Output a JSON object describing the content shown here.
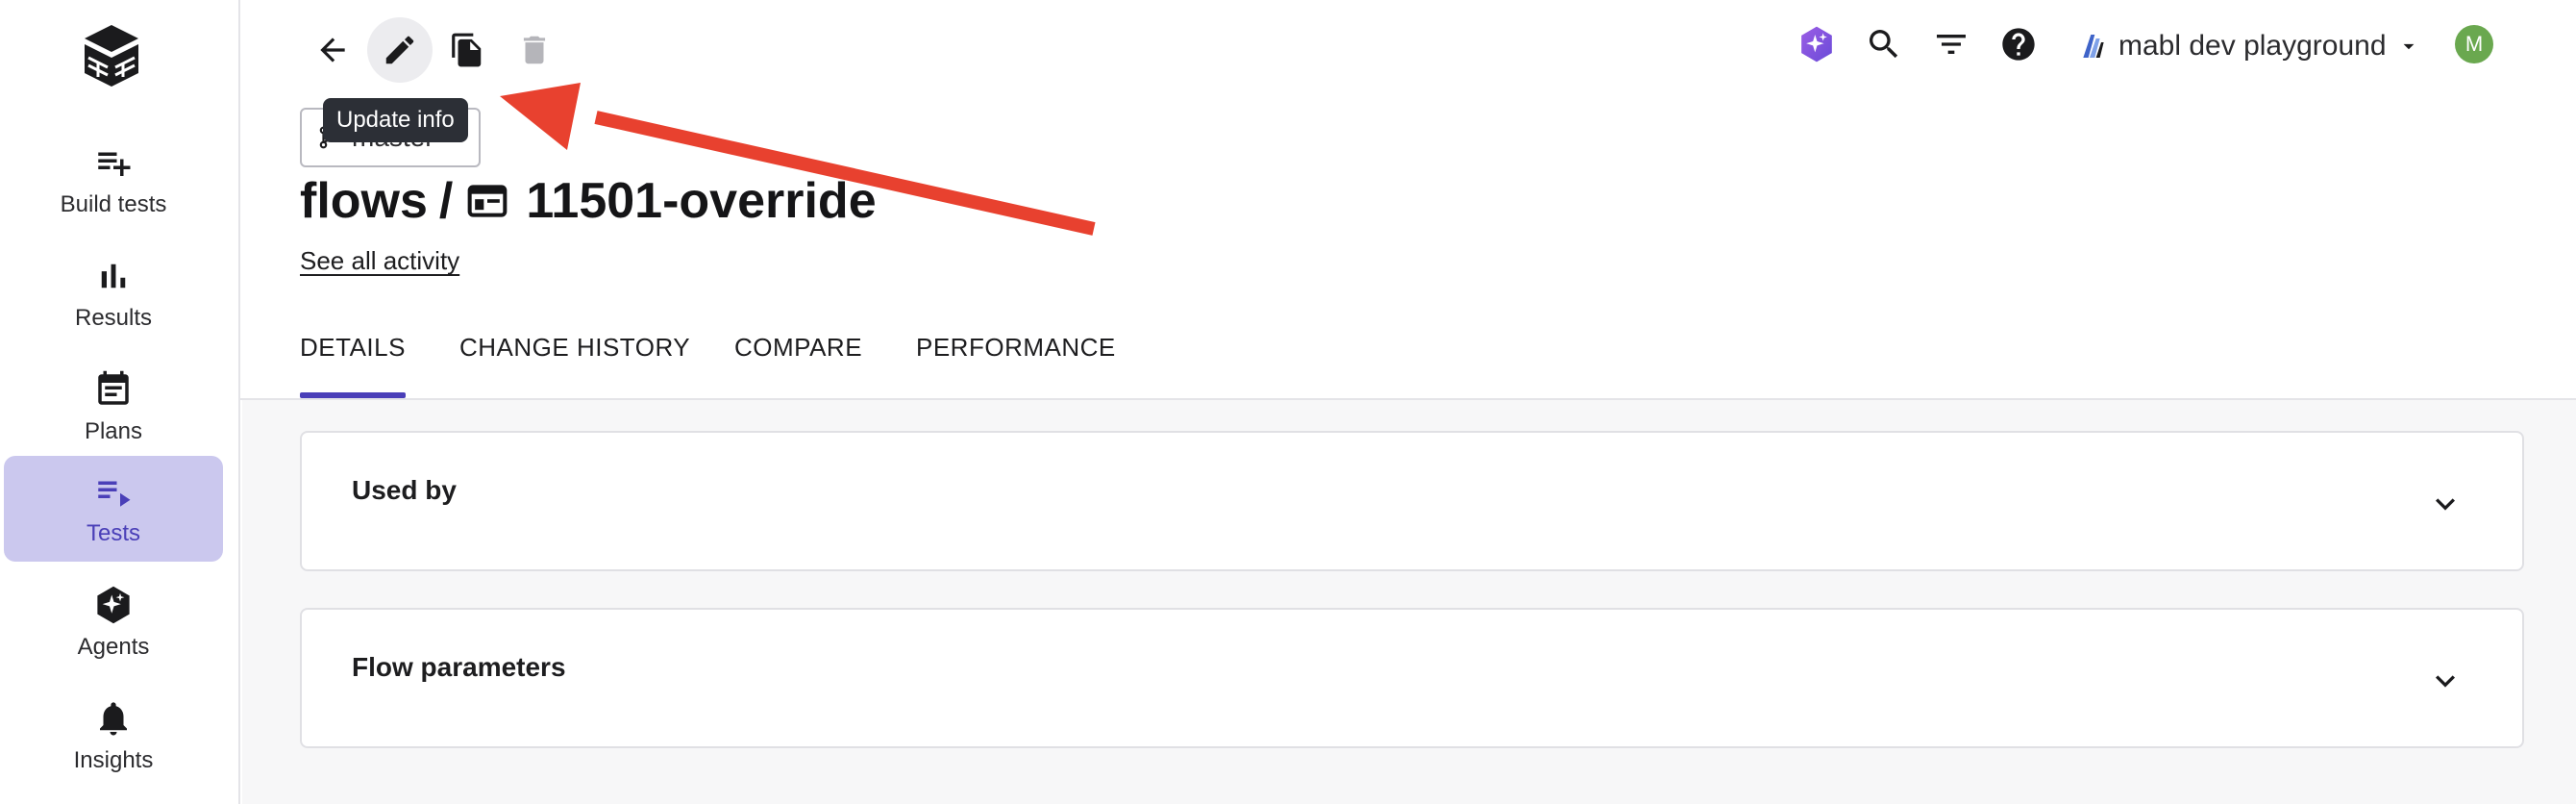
{
  "sidebar": {
    "items": [
      {
        "label": "Build tests",
        "icon": "playlist-add-icon"
      },
      {
        "label": "Results",
        "icon": "bar-chart-icon"
      },
      {
        "label": "Plans",
        "icon": "calendar-icon"
      },
      {
        "label": "Tests",
        "icon": "playlist-play-icon",
        "active": true
      },
      {
        "label": "Agents",
        "icon": "sparkle-hexagon-icon"
      },
      {
        "label": "Insights",
        "icon": "bell-icon"
      }
    ]
  },
  "toolbar": {
    "tooltip": "Update info"
  },
  "header": {
    "branch": "master",
    "breadcrumb_parent": "flows",
    "breadcrumb_sep": "/",
    "title": "11501-override",
    "see_all_activity": "See all activity"
  },
  "top_right": {
    "workspace_name": "mabl dev playground",
    "avatar_initial": "M"
  },
  "tabs": [
    {
      "label": "DETAILS",
      "active": true
    },
    {
      "label": "CHANGE HISTORY"
    },
    {
      "label": "COMPARE"
    },
    {
      "label": "PERFORMANCE"
    }
  ],
  "panels": [
    {
      "title": "Used by"
    },
    {
      "title": "Flow parameters"
    }
  ],
  "colors": {
    "accent": "#4a3fb8",
    "active_nav_bg": "#cbc8ee",
    "annotation_arrow": "#e8412f",
    "avatar": "#6aa84f"
  }
}
